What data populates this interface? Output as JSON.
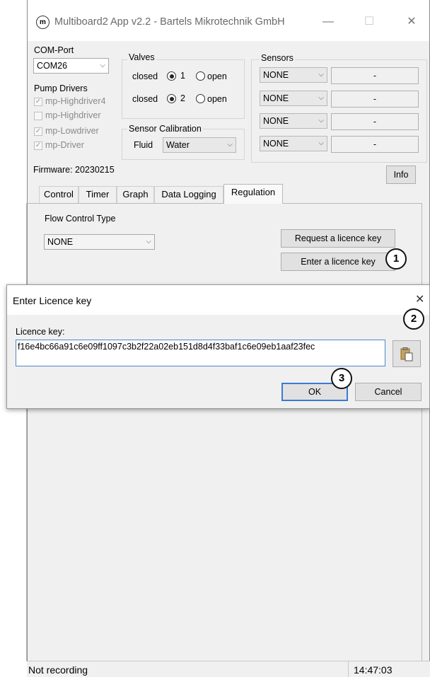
{
  "window": {
    "title": "Multiboard2 App v2.2 - Bartels Mikrotechnik GmbH",
    "logo_letter": "m",
    "minimize": "—",
    "maximize": "☐",
    "close": "✕"
  },
  "com_port": {
    "label": "COM-Port",
    "value": "COM26"
  },
  "pump_drivers": {
    "label": "Pump Drivers",
    "items": [
      {
        "label": "mp-Highdriver4",
        "checked": true
      },
      {
        "label": "mp-Highdriver",
        "checked": false
      },
      {
        "label": "mp-Lowdriver",
        "checked": true
      },
      {
        "label": "mp-Driver",
        "checked": true
      }
    ]
  },
  "valves": {
    "label": "Valves",
    "rows": [
      {
        "left": "closed",
        "number": "1",
        "right": "open"
      },
      {
        "left": "closed",
        "number": "2",
        "right": "open"
      }
    ]
  },
  "sensor_calibration": {
    "label": "Sensor Calibration",
    "fluid_label": "Fluid",
    "fluid_value": "Water"
  },
  "sensors": {
    "label": "Sensors",
    "rows": [
      {
        "type": "NONE",
        "value": "-"
      },
      {
        "type": "NONE",
        "value": "-"
      },
      {
        "type": "NONE",
        "value": "-"
      },
      {
        "type": "NONE",
        "value": "-"
      }
    ]
  },
  "firmware": "Firmware: 20230215",
  "info_button": "Info",
  "tabs": [
    "Control",
    "Timer",
    "Graph",
    "Data Logging",
    "Regulation"
  ],
  "active_tab": "Regulation",
  "regulation": {
    "flow_control_label": "Flow Control Type",
    "flow_control_value": "NONE",
    "request_button": "Request a licence key",
    "enter_button": "Enter a licence key"
  },
  "status": {
    "recording": "Not recording",
    "time": "14:47:03"
  },
  "dialog": {
    "title": "Enter Licence key",
    "close": "✕",
    "field_label": "Licence key:",
    "field_value": "f16e4bc66a91c6e09ff1097c3b2f22a02eb151d8d4f33baf1c6e09eb1aaf23fec",
    "ok": "OK",
    "cancel": "Cancel"
  },
  "callouts": [
    "1",
    "2",
    "3"
  ]
}
